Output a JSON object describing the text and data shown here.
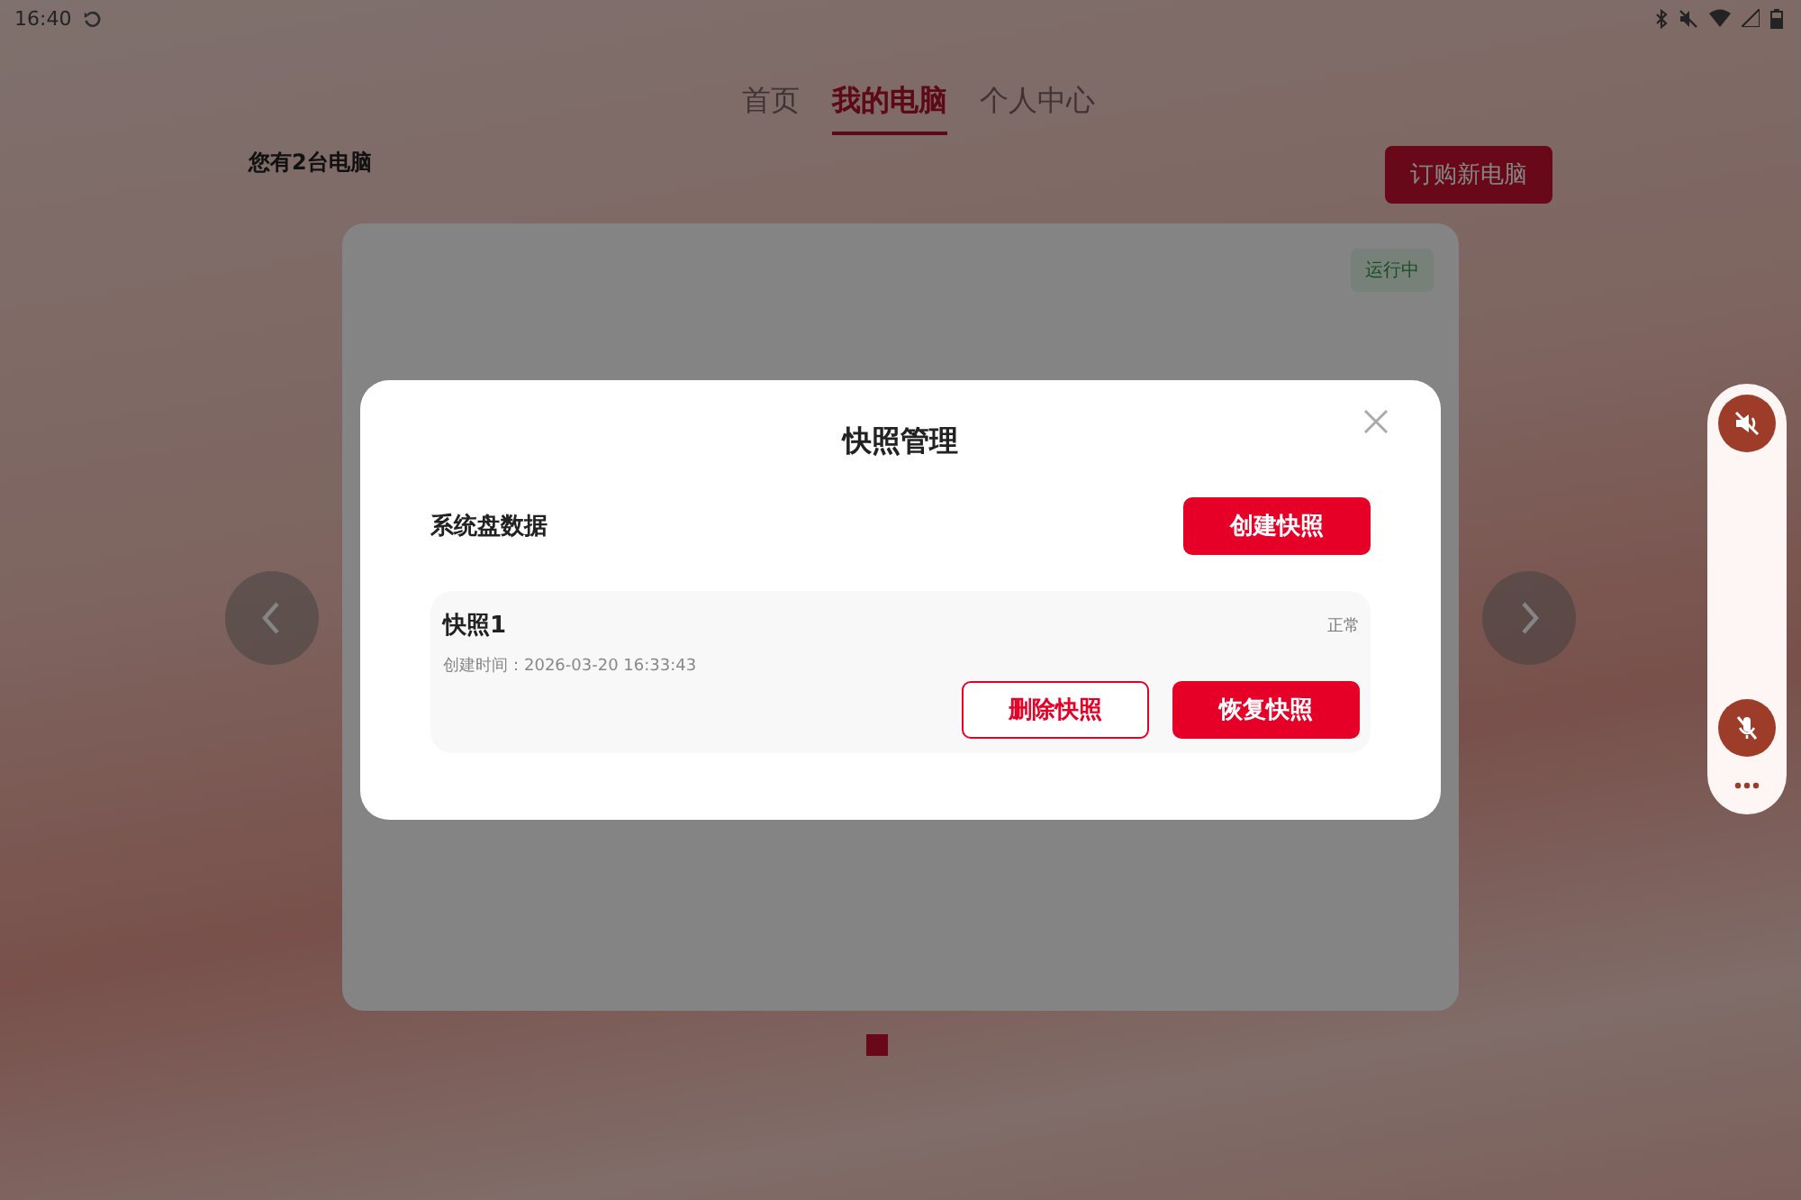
{
  "status_bar": {
    "time": "16:40"
  },
  "tabs": [
    {
      "label": "首页",
      "selected": false
    },
    {
      "label": "我的电脑",
      "selected": true
    },
    {
      "label": "个人中心",
      "selected": false
    }
  ],
  "computer_count": "您有2台电脑",
  "order_button": "订购新电脑",
  "computer_card": {
    "status": "运行中"
  },
  "pager": [
    {
      "selected": true
    }
  ],
  "dialog": {
    "title": "快照管理",
    "section": "系统盘数据",
    "create_button": "创建快照",
    "snapshots": [
      {
        "name": "快照1",
        "status": "正常",
        "created": "创建时间：2026-03-20 16:33:43",
        "actions": [
          {
            "label": "删除快照",
            "kind": "secondary"
          },
          {
            "label": "恢复快照",
            "kind": "primary"
          }
        ]
      }
    ]
  }
}
